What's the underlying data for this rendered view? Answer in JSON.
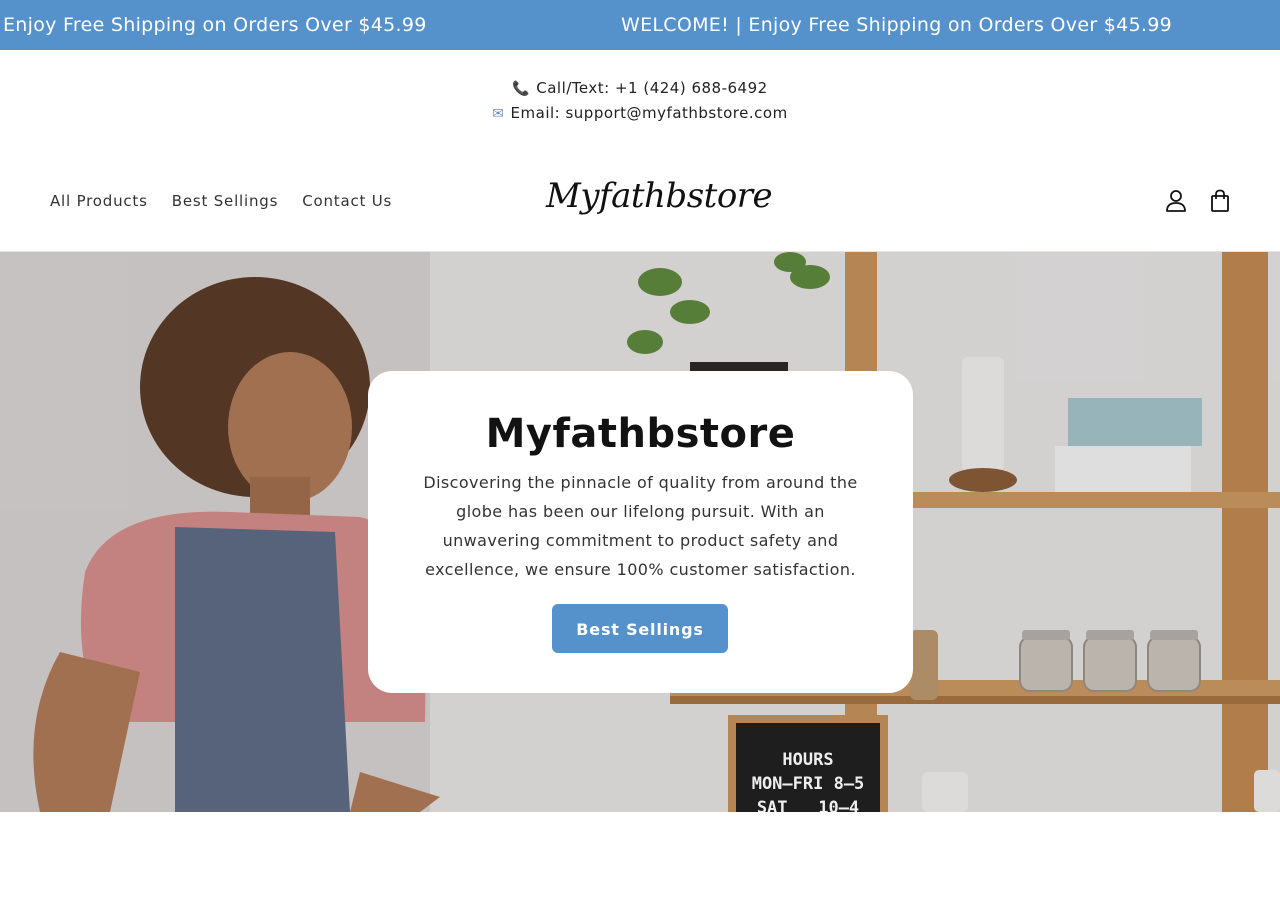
{
  "announcement": {
    "messages": [
      "Enjoy Free Shipping on Orders Over $45.99",
      "WELCOME! | Enjoy Free Shipping on Orders Over $45.99"
    ]
  },
  "contact": {
    "phone_icon": "phone-icon",
    "phone": "Call/Text: +1 (424) 688-6492",
    "email_icon": "envelope-icon",
    "email": "Email: support@myfathbstore.com"
  },
  "header": {
    "nav": [
      "All Products",
      "Best Sellings",
      "Contact Us"
    ],
    "logo": "Myfathbstore",
    "icons": [
      "account-icon",
      "cart-icon"
    ]
  },
  "hero": {
    "title": "Myfathbstore",
    "description": "Discovering the pinnacle of quality from around the globe has been our lifelong pursuit. With an unwavering commitment to product safety and excellence, we ensure 100% customer satisfaction.",
    "button": "Best Sellings",
    "sign": {
      "line1": "HOURS",
      "line2": "MON—FRI 8—5",
      "line3": "SAT   10—4"
    }
  },
  "colors": {
    "accent": "#5591ca",
    "text": "#1a1a1a"
  }
}
